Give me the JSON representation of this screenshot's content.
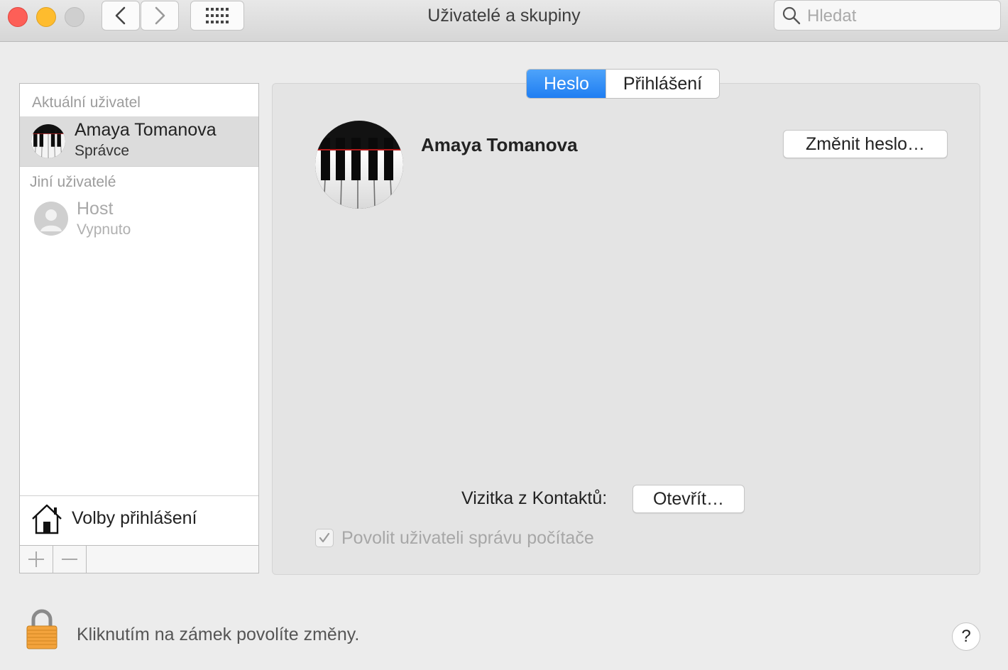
{
  "window": {
    "title": "Uživatelé a skupiny",
    "search_placeholder": "Hledat"
  },
  "sidebar": {
    "current_section_label": "Aktuální uživatel",
    "current_user": {
      "name": "Amaya Tomanova",
      "role": "Správce"
    },
    "other_section_label": "Jiní uživatelé",
    "other_users": [
      {
        "name": "Host",
        "status": "Vypnuto"
      }
    ],
    "login_options_label": "Volby přihlášení"
  },
  "tabs": [
    {
      "label": "Heslo",
      "active": true
    },
    {
      "label": "Přihlášení",
      "active": false
    }
  ],
  "detail": {
    "user_name": "Amaya Tomanova",
    "change_password_label": "Změnit heslo…",
    "contacts_label": "Vizitka z Kontaktů:",
    "open_button_label": "Otevřít…",
    "admin_checkbox_label": "Povolit uživateli správu počítače",
    "admin_checkbox_checked": true
  },
  "footer": {
    "lock_text": "Kliknutím na zámek povolíte změny.",
    "help_label": "?"
  },
  "colors": {
    "accent": "#1f7ef2",
    "close": "#fd5f57",
    "minimize": "#febc2e",
    "lock": "#f3a33c"
  }
}
